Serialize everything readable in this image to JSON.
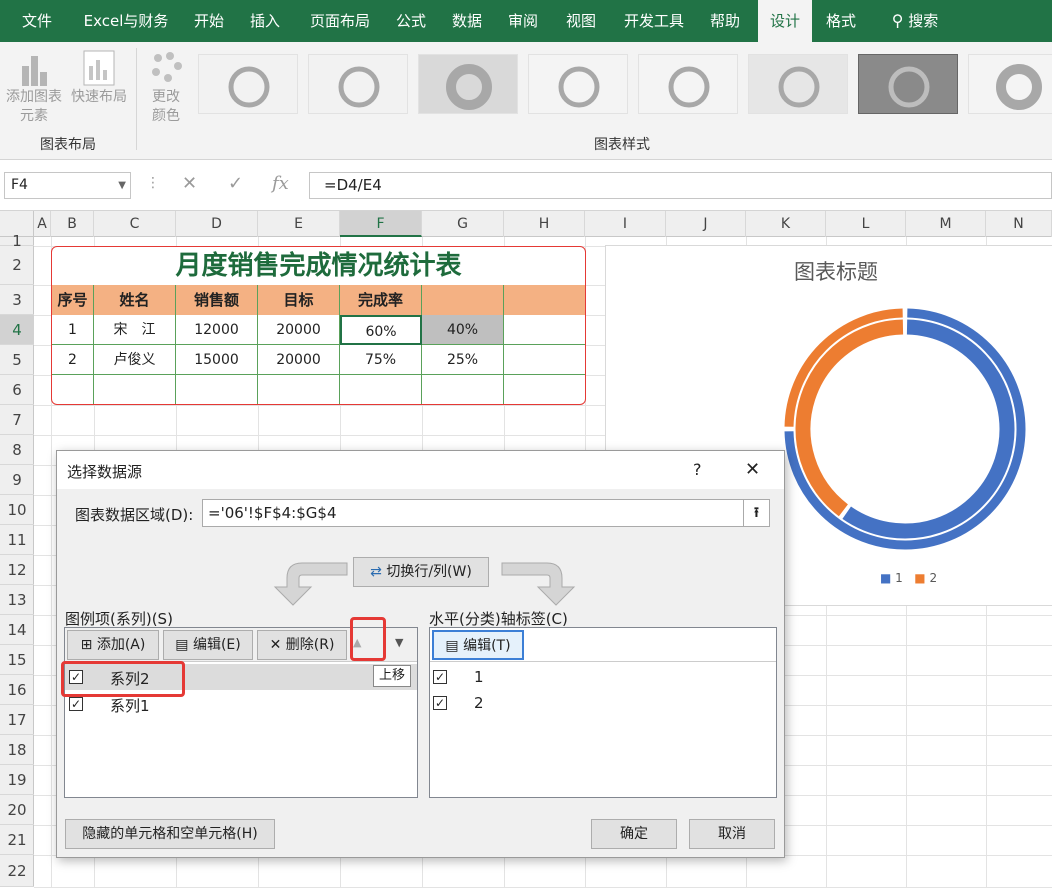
{
  "ribbon": {
    "tabs": [
      "文件",
      "Excel与财务",
      "开始",
      "插入",
      "页面布局",
      "公式",
      "数据",
      "审阅",
      "视图",
      "开发工具",
      "帮助",
      "设计",
      "格式"
    ],
    "selected_tab": "设计",
    "search_label": "搜索",
    "buttons": {
      "add_chart_element": "添加图表\n元素",
      "quick_layout": "快速布局",
      "change_colors": "更改\n颜色"
    },
    "groups": {
      "layout": "图表布局",
      "styles": "图表样式"
    }
  },
  "formula_bar": {
    "name_box": "F4",
    "formula": "=D4/E4"
  },
  "columns": [
    "A",
    "B",
    "C",
    "D",
    "E",
    "F",
    "G",
    "H",
    "I",
    "J",
    "K",
    "L",
    "M",
    "N"
  ],
  "rows": [
    "1",
    "2",
    "3",
    "4",
    "5",
    "6",
    "7",
    "8",
    "9",
    "10",
    "11",
    "12",
    "13",
    "14",
    "15",
    "16",
    "17",
    "18",
    "19",
    "20",
    "21",
    "22"
  ],
  "sheet_table": {
    "title": "月度销售完成情况统计表",
    "headers": [
      "序号",
      "姓名",
      "销售额",
      "目标",
      "完成率",
      ""
    ],
    "rows": [
      [
        "1",
        "宋　江",
        "12000",
        "20000",
        "60%",
        "40%"
      ],
      [
        "2",
        "卢俊义",
        "15000",
        "20000",
        "75%",
        "25%"
      ]
    ]
  },
  "chart": {
    "title": "图表标题",
    "legend": [
      "1",
      "2"
    ],
    "colors": {
      "blue": "#4472c4",
      "orange": "#ed7d31"
    }
  },
  "chart_data": {
    "type": "donut",
    "title": "图表标题",
    "categories": [
      "1",
      "2"
    ],
    "series": [
      {
        "name": "系列1",
        "values": [
          60,
          40
        ]
      },
      {
        "name": "系列2",
        "values": [
          75,
          25
        ]
      }
    ],
    "legend_position": "bottom"
  },
  "dialog": {
    "title": "选择数据源",
    "help": "?",
    "close": "✕",
    "range_label": "图表数据区域(D):",
    "range_value": "='06'!$F$4:$G$4",
    "switch_button": "切换行/列(W)",
    "series_label": "图例项(系列)(S)",
    "axis_label": "水平(分类)轴标签(C)",
    "add_button": "添加(A)",
    "edit_button": "编辑(E)",
    "delete_button": "删除(R)",
    "move_up_tooltip": "上移",
    "axis_edit_button": "编辑(T)",
    "series_items": [
      {
        "name": "系列2",
        "checked": true
      },
      {
        "name": "系列1",
        "checked": true
      }
    ],
    "axis_items": [
      {
        "name": "1",
        "checked": true
      },
      {
        "name": "2",
        "checked": true
      }
    ],
    "hidden_cells_button": "隐藏的单元格和空单元格(H)",
    "ok_button": "确定",
    "cancel_button": "取消"
  }
}
